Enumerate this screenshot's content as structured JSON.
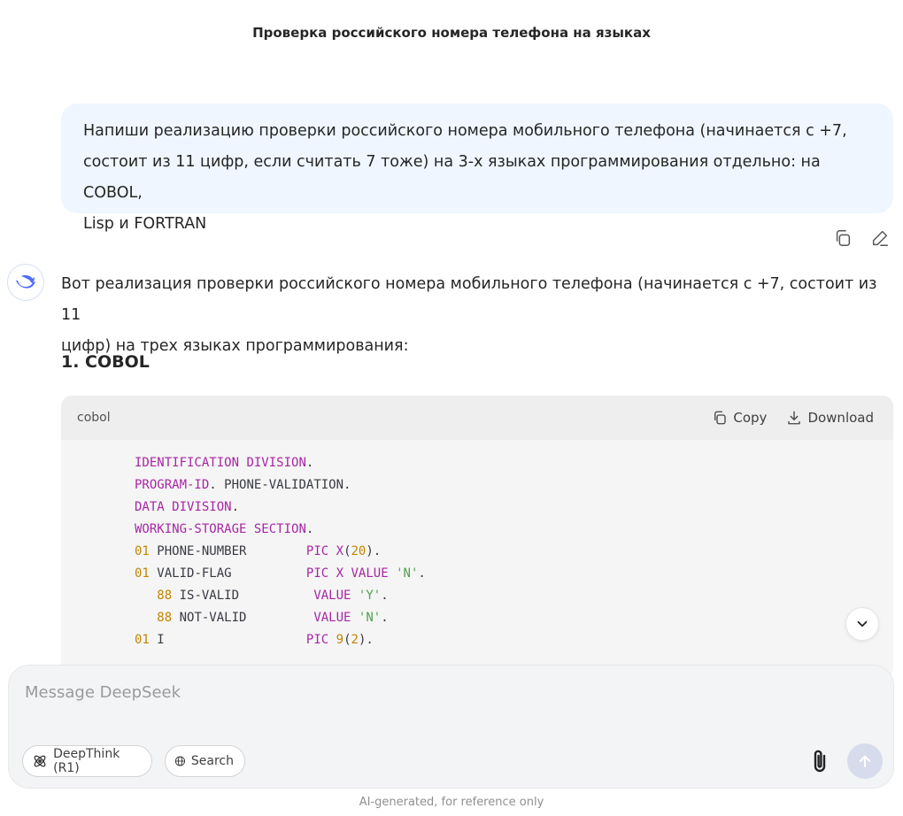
{
  "header": {
    "title": "Проверка российского номера телефона на языках"
  },
  "user_message": {
    "lines": [
      "Напиши реализацию проверки российского номера мобильного телефона (начинается с +7,",
      "состоит из 11 цифр, если считать 7 тоже) на 3-х языках программирования отдельно: на COBOL,",
      "Lisp и FORTRAN"
    ]
  },
  "message_actions": {
    "icons": [
      "copy-icon",
      "edit-icon"
    ]
  },
  "assistant": {
    "avatar_icon": "deepseek-whale-icon",
    "intro_lines": [
      "Вот реализация проверки российского номера мобильного телефона (начинается с +7, состоит из 11",
      "цифр) на трех языках программирования:"
    ],
    "section_heading": "1. COBOL",
    "code_block": {
      "language": "cobol",
      "copy_label": "Copy",
      "download_label": "Download",
      "lines": [
        "IDENTIFICATION DIVISION.",
        "PROGRAM-ID. PHONE-VALIDATION.",
        "DATA DIVISION.",
        "WORKING-STORAGE SECTION.",
        "01 PHONE-NUMBER        PIC X(20).",
        "01 VALID-FLAG          PIC X VALUE 'N'.",
        "   88 IS-VALID          VALUE 'Y'.",
        "   88 NOT-VALID         VALUE 'N'.",
        "01 I                   PIC 9(2)."
      ]
    }
  },
  "composer": {
    "placeholder": "Message DeepSeek",
    "deepthink_label": "DeepThink (R1)",
    "search_label": "Search"
  },
  "footer": {
    "disclaimer": "AI-generated, for reference only"
  },
  "colors": {
    "accent": "#4d6bfe",
    "user_bubble": "#eff6ff",
    "keyword": "#a626a4",
    "number": "#c18401",
    "string": "#50a14f"
  }
}
